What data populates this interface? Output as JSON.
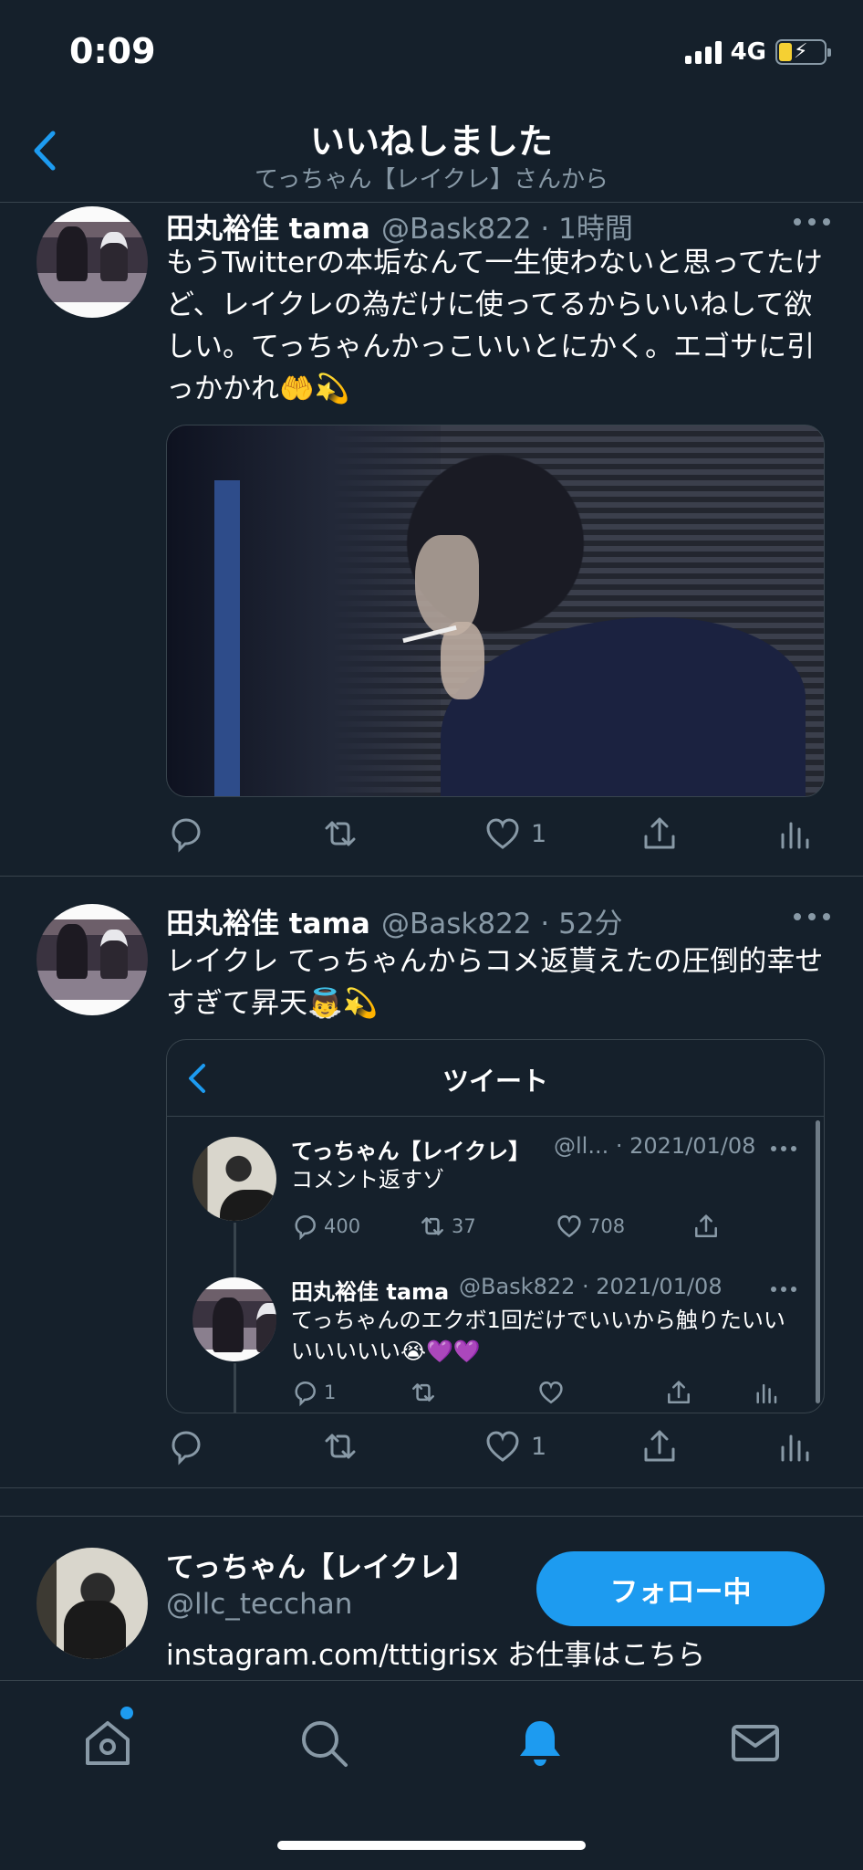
{
  "status_bar": {
    "time": "0:09",
    "network": "4G"
  },
  "header": {
    "title": "いいねしました",
    "subtitle": "てっちゃん【レイクレ】さんから"
  },
  "tweets": [
    {
      "name": "田丸裕佳 tama",
      "handle": "@Bask822 · 1時間",
      "text": "もうTwitterの本垢なんて一生使わないと思ってたけど、レイクレの為だけに使ってるからいいねして欲しい。てっちゃんかっこいいとにかく。エゴサに引っかかれ🤲💫",
      "has_photo": true,
      "actions": {
        "reply": "",
        "retweet": "",
        "like": "1"
      }
    },
    {
      "name": "田丸裕佳 tama",
      "handle": "@Bask822 · 52分",
      "text": "レイクレ てっちゃんからコメ返貰えたの圧倒的幸せすぎて昇天👼💫",
      "actions": {
        "reply": "",
        "retweet": "",
        "like": "1"
      },
      "quote": {
        "title": "ツイート",
        "items": [
          {
            "name": "てっちゃん【レイクレ】",
            "handle": "@ll... · 2021/01/08",
            "text": "コメント返すゾ",
            "reply": "400",
            "retweet": "37",
            "like": "708"
          },
          {
            "name": "田丸裕佳 tama",
            "handle": "@Bask822 · 2021/01/08",
            "text": "てっちゃんのエクボ1回だけでいいから触りたいいいいいいい😭💜💜",
            "reply": "1",
            "retweet": "",
            "like": ""
          }
        ]
      }
    }
  ],
  "profile_card": {
    "name": "てっちゃん【レイクレ】",
    "handle": "@llc_tecchan",
    "bio": "instagram.com/tttigrisx お仕事はこちら",
    "follow_label": "フォロー中"
  },
  "colors": {
    "background": "#15202b",
    "accent": "#1d9bf0",
    "secondary_text": "#8899a6"
  },
  "tabs": [
    "home-icon",
    "search-icon",
    "bell-icon",
    "mail-icon"
  ]
}
